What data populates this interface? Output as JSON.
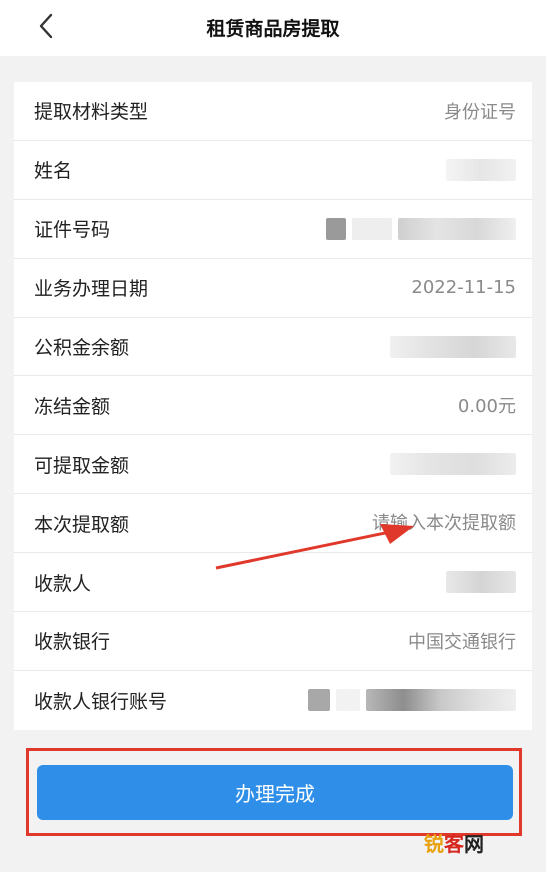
{
  "header": {
    "title": "租赁商品房提取",
    "back_icon": "chevron-left-icon"
  },
  "rows": [
    {
      "label": "提取材料类型",
      "value": "身份证号"
    },
    {
      "label": "姓名",
      "value": ""
    },
    {
      "label": "证件号码",
      "value": ""
    },
    {
      "label": "业务办理日期",
      "value": "2022-11-15"
    },
    {
      "label": "公积金余额",
      "value": ""
    },
    {
      "label": "冻结金额",
      "value": "0.00元"
    },
    {
      "label": "可提取金额",
      "value": ""
    },
    {
      "label": "本次提取额",
      "placeholder": "请输入本次提取额"
    },
    {
      "label": "收款人",
      "value": ""
    },
    {
      "label": "收款银行",
      "value": "中国交通银行"
    },
    {
      "label": "收款人银行账号",
      "value": ""
    }
  ],
  "footer": {
    "submit_label": "办理完成"
  },
  "annotation": {
    "highlight_color": "#e0392b"
  },
  "watermark": {
    "part1": "锐",
    "part2": "客",
    "part3": "网"
  },
  "colors": {
    "primary": "#2f8fe8",
    "accent_red": "#e0392b"
  }
}
